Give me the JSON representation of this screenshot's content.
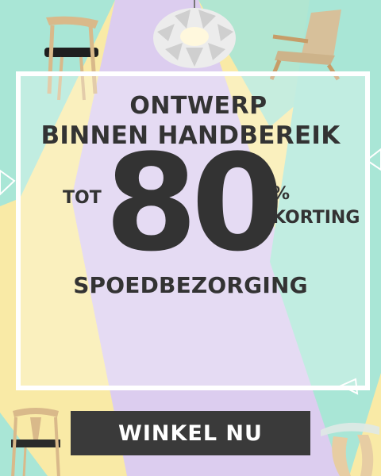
{
  "banner": {
    "headline_line1": "ONTWERP",
    "headline_line2": "BINNEN HANDBEREIK",
    "prefix": "TOT",
    "discount_value": "80",
    "percent_sign": "%",
    "discount_word": "KORTING",
    "subheadline": "SPOEDBEZORGING",
    "cta_label": "WINKEL NU"
  },
  "colors": {
    "mint": "#a9e6d6",
    "lavender": "#dccdef",
    "yellow": "#f9eaa6",
    "text": "#333333",
    "button": "#3a3a3a",
    "button_text": "#ffffff",
    "frame": "#ffffff"
  },
  "icons": [
    "chair-icon",
    "pendant-lamp-icon",
    "lounge-chair-icon",
    "wishbone-chair-icon",
    "coffee-table-icon"
  ]
}
